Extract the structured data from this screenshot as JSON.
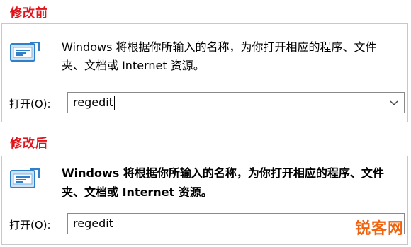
{
  "before": {
    "title": "修改前",
    "description": "Windows 将根据你所输入的名称，为你打开相应的程序、文件夹、文档或 Internet 资源。",
    "open_label": "打开(O):",
    "input_value": "regedit"
  },
  "after": {
    "title": "修改后",
    "description": "Windows 将根据你所输入的名称，为你打开相应的程序、文件夹、文档或 Internet 资源。",
    "open_label": "打开(O):",
    "input_value": "regedit"
  },
  "watermark": "锐客网",
  "colors": {
    "title_red": "#e0141b",
    "watermark_orange": "#f2610c",
    "icon_blue": "#2f80c8"
  },
  "icons": {
    "run": "run-dialog-icon",
    "dropdown": "chevron-down-icon"
  }
}
